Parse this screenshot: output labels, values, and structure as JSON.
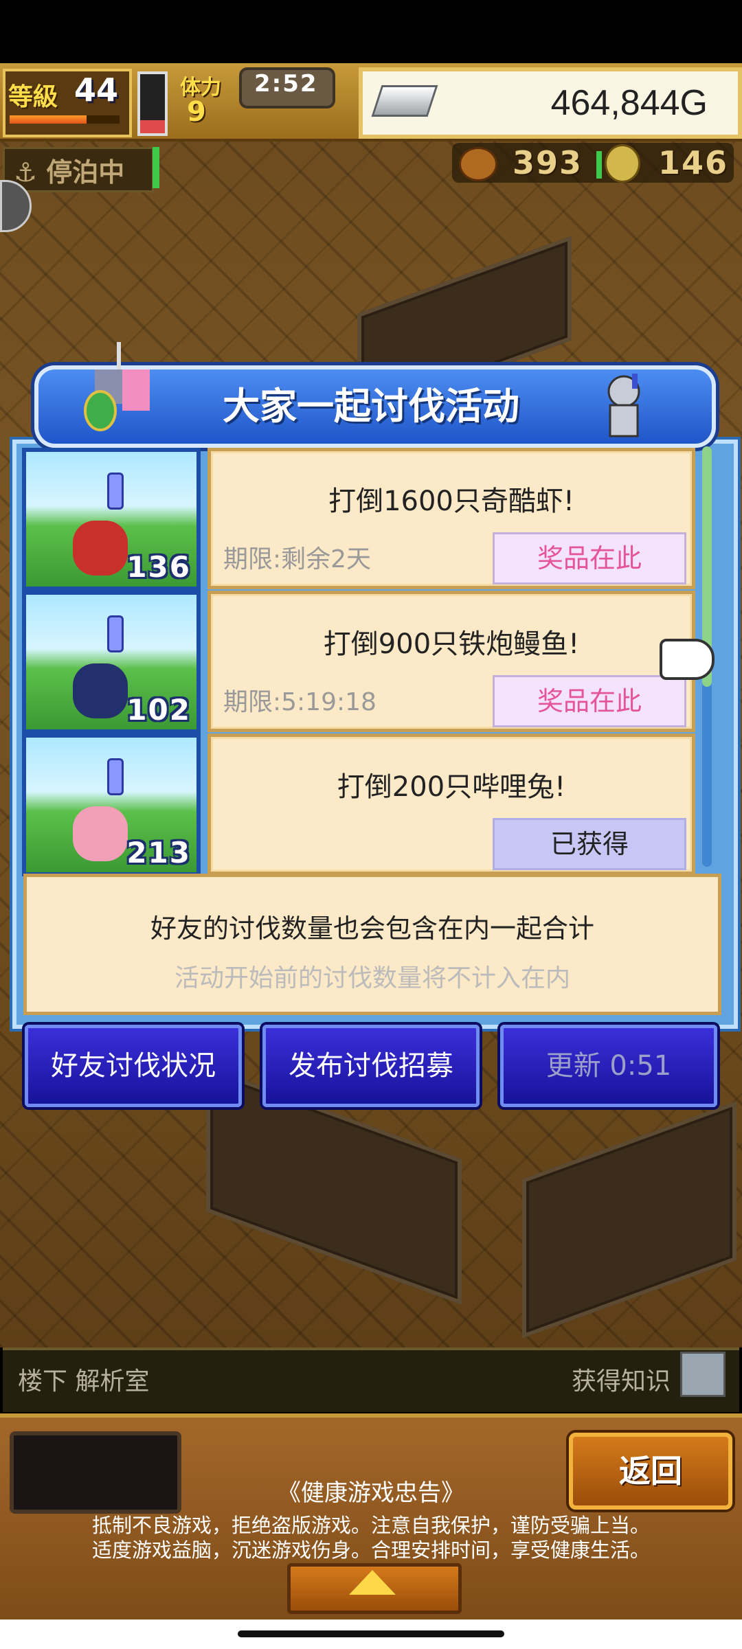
{
  "hud": {
    "level_label": "等級",
    "level": "44",
    "stamina_label": "体力",
    "stamina_value": "9",
    "timer": "2:52",
    "gold": "464,844G",
    "dock_status": "停泊中",
    "resource1": "393",
    "resource2": "146"
  },
  "dialog": {
    "title": "大家一起讨伐活动",
    "missions": [
      {
        "title": "打倒1600只奇酷虾!",
        "deadline": "期限:剩余2天",
        "reward_label": "奖品在此",
        "count": "136",
        "monster_color": "#c9302c"
      },
      {
        "title": "打倒900只铁炮鳗鱼!",
        "deadline": "期限:5:19:18",
        "reward_label": "奖品在此",
        "count": "102",
        "monster_color": "#22306b"
      },
      {
        "title": "打倒200只哔哩兔!",
        "deadline": "",
        "reward_label": "已获得",
        "count": "213",
        "monster_color": "#f2a0b8"
      }
    ],
    "info_line1": "好友的讨伐数量也会包含在内一起合计",
    "info_line2": "活动开始前的讨伐数量将不计入在内"
  },
  "actions": {
    "friends_status": "好友讨伐状况",
    "post_recruit": "发布讨伐招募",
    "refresh": "更新 0:51"
  },
  "location": {
    "room": "楼下 解析室",
    "knowledge": "获得知识"
  },
  "bottom": {
    "back_label": "返回",
    "notice_title": "《健康游戏忠告》",
    "notice_line1": "抵制不良游戏，拒绝盗版游戏。注意自我保护，谨防受骗上当。",
    "notice_line2": "适度游戏益脑，沉迷游戏伤身。合理安排时间，享受健康生活。"
  },
  "colors": {
    "dialog_blue": "#5fa3e0",
    "card_cream": "#fbe9c7",
    "reward_pink": "#e4549a",
    "button_blue": "#17129a"
  }
}
